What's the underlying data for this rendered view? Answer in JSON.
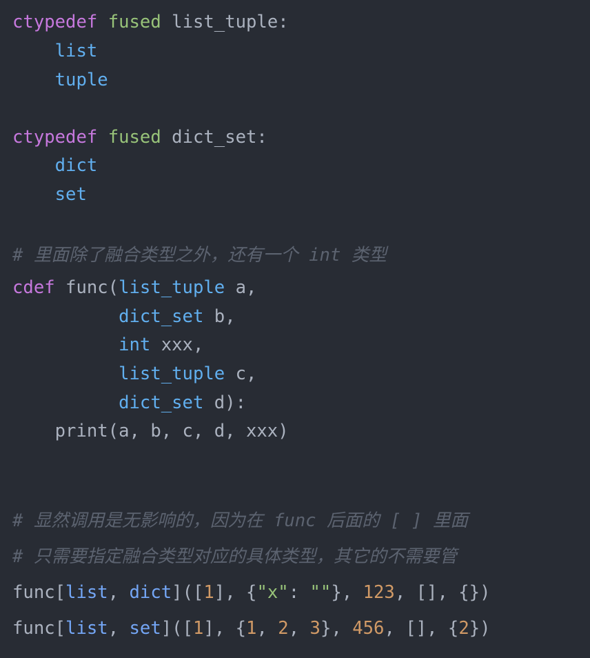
{
  "code": {
    "lines": [
      [
        {
          "t": "ctypedef",
          "c": "kw"
        },
        {
          "t": " ",
          "c": "plain"
        },
        {
          "t": "fused",
          "c": "fused"
        },
        {
          "t": " list_tuple:",
          "c": "plain"
        }
      ],
      [
        {
          "t": "    ",
          "c": "plain"
        },
        {
          "t": "list",
          "c": "ty"
        }
      ],
      [
        {
          "t": "    ",
          "c": "plain"
        },
        {
          "t": "tuple",
          "c": "ty"
        }
      ],
      [],
      [
        {
          "t": "ctypedef",
          "c": "kw"
        },
        {
          "t": " ",
          "c": "plain"
        },
        {
          "t": "fused",
          "c": "fused"
        },
        {
          "t": " dict_set:",
          "c": "plain"
        }
      ],
      [
        {
          "t": "    ",
          "c": "plain"
        },
        {
          "t": "dict",
          "c": "ty"
        }
      ],
      [
        {
          "t": "    ",
          "c": "plain"
        },
        {
          "t": "set",
          "c": "ty"
        }
      ],
      [],
      [
        {
          "t": "# 里面除了融合类型之外，还有一个 int 类型",
          "c": "comment"
        }
      ],
      [
        {
          "t": "cdef",
          "c": "kw"
        },
        {
          "t": " func(",
          "c": "plain"
        },
        {
          "t": "list_tuple",
          "c": "ty"
        },
        {
          "t": " a,",
          "c": "plain"
        }
      ],
      [
        {
          "t": "          ",
          "c": "plain"
        },
        {
          "t": "dict_set",
          "c": "ty"
        },
        {
          "t": " b,",
          "c": "plain"
        }
      ],
      [
        {
          "t": "          ",
          "c": "plain"
        },
        {
          "t": "int",
          "c": "ty"
        },
        {
          "t": " xxx,",
          "c": "plain"
        }
      ],
      [
        {
          "t": "          ",
          "c": "plain"
        },
        {
          "t": "list_tuple",
          "c": "ty"
        },
        {
          "t": " c,",
          "c": "plain"
        }
      ],
      [
        {
          "t": "          ",
          "c": "plain"
        },
        {
          "t": "dict_set",
          "c": "ty"
        },
        {
          "t": " d):",
          "c": "plain"
        }
      ],
      [
        {
          "t": "    print(a, b, c, d, xxx)",
          "c": "plain"
        }
      ],
      [],
      [],
      [
        {
          "t": "# 显然调用是无影响的，因为在 func 后面的 [ ] 里面",
          "c": "comment"
        }
      ],
      [
        {
          "t": "# 只需要指定融合类型对应的具体类型，其它的不需要管",
          "c": "comment"
        }
      ],
      [
        {
          "t": "func[",
          "c": "plain"
        },
        {
          "t": "list",
          "c": "ty2"
        },
        {
          "t": ", ",
          "c": "plain"
        },
        {
          "t": "dict",
          "c": "ty2"
        },
        {
          "t": "]([",
          "c": "plain"
        },
        {
          "t": "1",
          "c": "num"
        },
        {
          "t": "], {",
          "c": "plain"
        },
        {
          "t": "\"x\"",
          "c": "str"
        },
        {
          "t": ": ",
          "c": "plain"
        },
        {
          "t": "\"\"",
          "c": "str"
        },
        {
          "t": "}, ",
          "c": "plain"
        },
        {
          "t": "123",
          "c": "num"
        },
        {
          "t": ", [], {})",
          "c": "plain"
        }
      ],
      [
        {
          "t": "func[",
          "c": "plain"
        },
        {
          "t": "list",
          "c": "ty2"
        },
        {
          "t": ", ",
          "c": "plain"
        },
        {
          "t": "set",
          "c": "ty2"
        },
        {
          "t": "]([",
          "c": "plain"
        },
        {
          "t": "1",
          "c": "num"
        },
        {
          "t": "], {",
          "c": "plain"
        },
        {
          "t": "1",
          "c": "num"
        },
        {
          "t": ", ",
          "c": "plain"
        },
        {
          "t": "2",
          "c": "num"
        },
        {
          "t": ", ",
          "c": "plain"
        },
        {
          "t": "3",
          "c": "num"
        },
        {
          "t": "}, ",
          "c": "plain"
        },
        {
          "t": "456",
          "c": "num"
        },
        {
          "t": ", [], {",
          "c": "plain"
        },
        {
          "t": "2",
          "c": "num"
        },
        {
          "t": "})",
          "c": "plain"
        }
      ]
    ],
    "colors": {
      "background": "#282c34",
      "keyword": "#c678dd",
      "fused": "#98c379",
      "type": "#61afef",
      "plain": "#abb2bf",
      "number": "#d19a66",
      "string": "#98c379",
      "comment": "#5c6370"
    }
  }
}
